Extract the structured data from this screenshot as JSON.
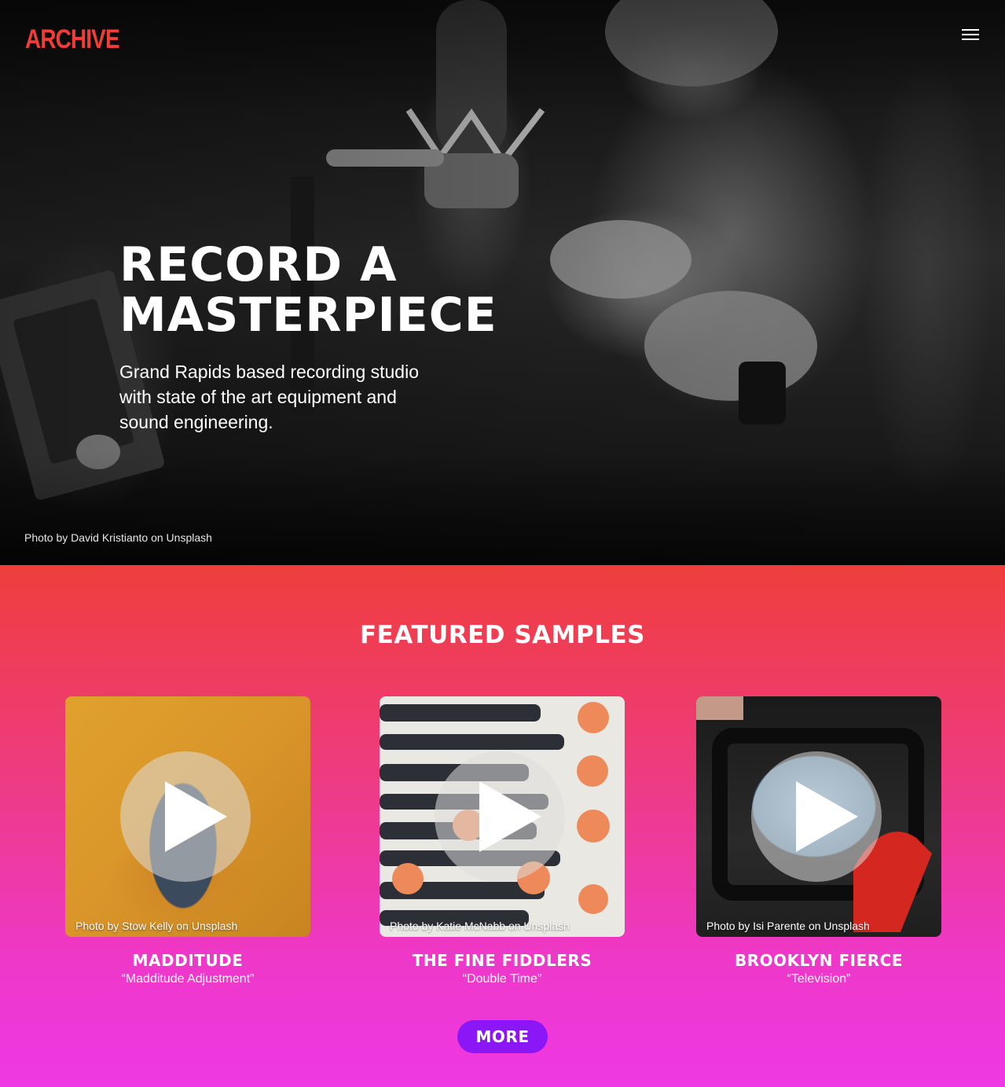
{
  "header": {
    "logo_text": "ARCHIVE",
    "menu_icon": "hamburger-menu-icon"
  },
  "hero": {
    "title": "RECORD A MASTERPIECE",
    "subtitle": "Grand Rapids based recording studio with state of the art equipment and sound engineering.",
    "photo_credit": "Photo by David Kristianto on Unsplash"
  },
  "featured": {
    "title": "FEATURED SAMPLES",
    "cards": [
      {
        "name": "MADDITUDE",
        "track": "“Madditude Adjustment”",
        "photo_credit": "Photo by Stow Kelly on Unsplash"
      },
      {
        "name": "THE FINE FIDDLERS",
        "track": "“Double Time”",
        "photo_credit": "Photo by Katie McNabb on Unsplash"
      },
      {
        "name": "BROOKLYN FIERCE",
        "track": "“Television”",
        "photo_credit": "Photo by Isi Parente on Unsplash"
      }
    ],
    "more_label": "MORE"
  },
  "colors": {
    "brand_red": "#ef3d3a",
    "gradient_top": "#ef3e3c",
    "gradient_bottom": "#ee38e4",
    "button_purple": "#8c17f6"
  }
}
